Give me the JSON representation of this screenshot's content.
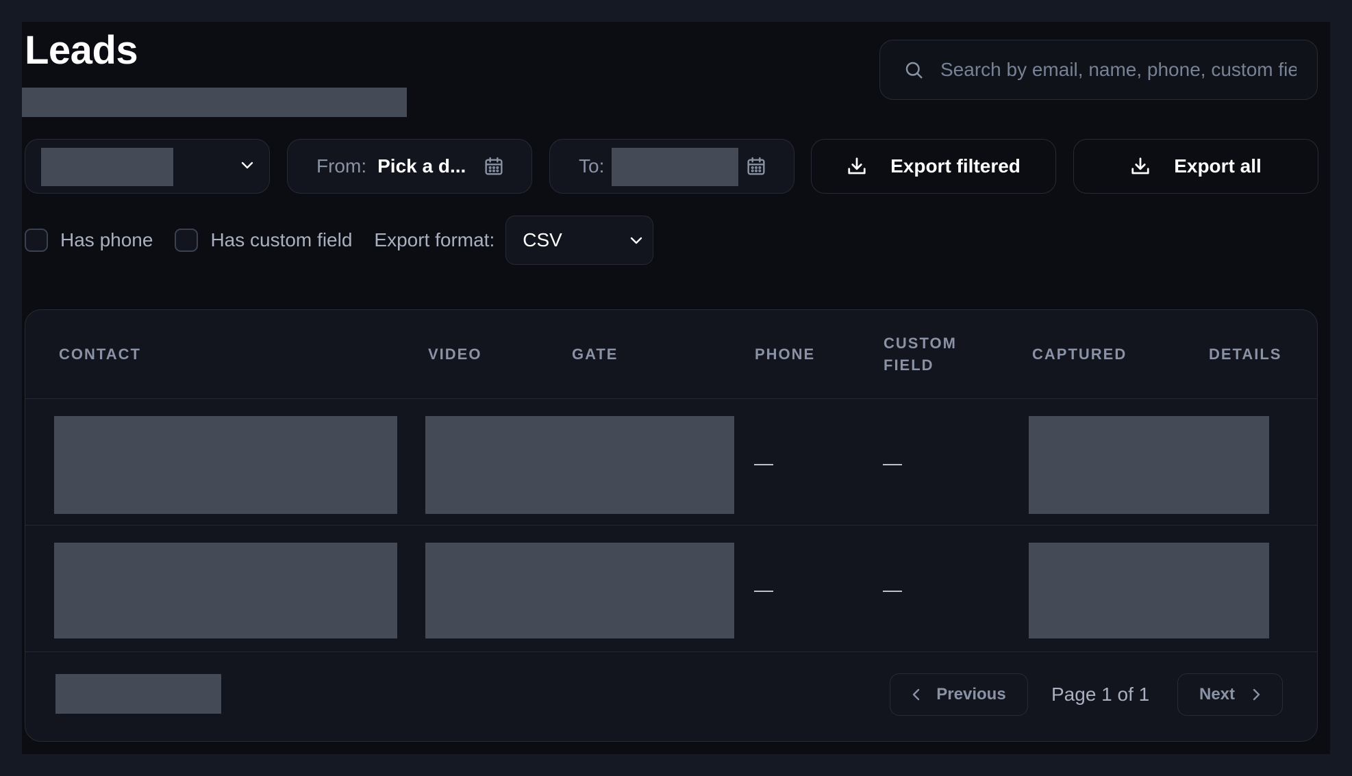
{
  "header": {
    "title": "Leads"
  },
  "search": {
    "placeholder": "Search by email, name, phone, custom field",
    "icon": "search-icon"
  },
  "filters": {
    "from_label": "From:",
    "from_value": "Pick a d...",
    "to_label": "To:",
    "export_filtered_label": "Export filtered",
    "export_all_label": "Export all",
    "has_phone_label": "Has phone",
    "has_phone_checked": false,
    "has_custom_field_label": "Has custom field",
    "has_custom_field_checked": false,
    "export_format_label": "Export format:",
    "export_format_value": "CSV"
  },
  "table": {
    "columns": {
      "contact": "CONTACT",
      "video": "VIDEO",
      "gate": "GATE",
      "phone": "PHONE",
      "custom_field_1": "CUSTOM",
      "custom_field_2": "FIELD",
      "captured": "CAPTURED",
      "details": "DETAILS"
    },
    "rows": [
      {
        "phone": "—",
        "custom_field": "—"
      },
      {
        "phone": "—",
        "custom_field": "—"
      }
    ]
  },
  "pagination": {
    "previous_label": "Previous",
    "page_info": "Page 1 of 1",
    "next_label": "Next"
  },
  "colors": {
    "background": "#151923",
    "panel": "#0b0d12",
    "card": "#12151d",
    "skeleton": "#454a57",
    "border": "#262b37"
  }
}
